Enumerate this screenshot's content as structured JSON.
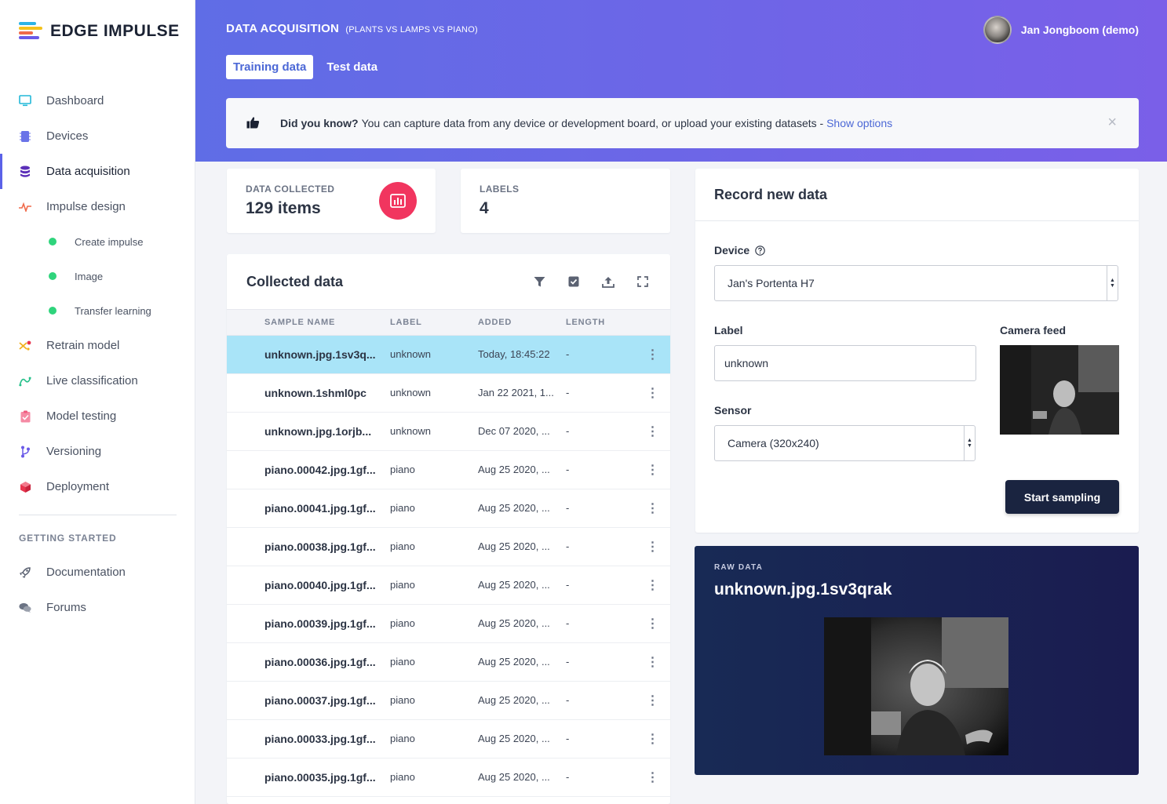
{
  "brand": {
    "name": "EDGE IMPULSE"
  },
  "nav": {
    "items": [
      {
        "label": "Dashboard",
        "icon": "monitor-icon",
        "color": "#22b8d8"
      },
      {
        "label": "Devices",
        "icon": "chip-icon",
        "color": "#6a73e8"
      },
      {
        "label": "Data acquisition",
        "icon": "database-icon",
        "color": "#5b2fb8"
      },
      {
        "label": "Impulse design",
        "icon": "pulse-icon",
        "color": "#f06a4a"
      }
    ],
    "sub_items": [
      {
        "label": "Create impulse"
      },
      {
        "label": "Image"
      },
      {
        "label": "Transfer learning"
      }
    ],
    "items2": [
      {
        "label": "Retrain model",
        "icon": "shuffle-icon",
        "color": "#f2b01e"
      },
      {
        "label": "Live classification",
        "icon": "graph-icon",
        "color": "#26c08a"
      },
      {
        "label": "Model testing",
        "icon": "clipboard-check-icon",
        "color": "#f05a7e"
      },
      {
        "label": "Versioning",
        "icon": "branch-icon",
        "color": "#6a5ae8"
      },
      {
        "label": "Deployment",
        "icon": "cube-icon",
        "color": "#e8354e"
      }
    ],
    "section_title": "GETTING STARTED",
    "help_items": [
      {
        "label": "Documentation",
        "icon": "rocket-icon"
      },
      {
        "label": "Forums",
        "icon": "chat-icon"
      }
    ]
  },
  "header": {
    "title": "DATA ACQUISITION",
    "subtitle": "(PLANTS VS LAMPS VS PIANO)",
    "user_name": "Jan Jongboom (demo)",
    "tabs": [
      {
        "label": "Training data"
      },
      {
        "label": "Test data"
      }
    ]
  },
  "banner": {
    "lead": "Did you know?",
    "text": "You can capture data from any device or development board, or upload your existing datasets -",
    "link": "Show options",
    "close": "×"
  },
  "stats": {
    "collected_label": "DATA COLLECTED",
    "collected_value": "129 items",
    "labels_label": "LABELS",
    "labels_value": "4"
  },
  "collected": {
    "title": "Collected data",
    "columns": [
      "SAMPLE NAME",
      "LABEL",
      "ADDED",
      "LENGTH"
    ],
    "rows": [
      {
        "name": "unknown.jpg.1sv3q...",
        "label": "unknown",
        "added": "Today, 18:45:22",
        "length": "-"
      },
      {
        "name": "unknown.1shml0pc",
        "label": "unknown",
        "added": "Jan 22 2021, 1...",
        "length": "-"
      },
      {
        "name": "unknown.jpg.1orjb...",
        "label": "unknown",
        "added": "Dec 07 2020, ...",
        "length": "-"
      },
      {
        "name": "piano.00042.jpg.1gf...",
        "label": "piano",
        "added": "Aug 25 2020, ...",
        "length": "-"
      },
      {
        "name": "piano.00041.jpg.1gf...",
        "label": "piano",
        "added": "Aug 25 2020, ...",
        "length": "-"
      },
      {
        "name": "piano.00038.jpg.1gf...",
        "label": "piano",
        "added": "Aug 25 2020, ...",
        "length": "-"
      },
      {
        "name": "piano.00040.jpg.1gf...",
        "label": "piano",
        "added": "Aug 25 2020, ...",
        "length": "-"
      },
      {
        "name": "piano.00039.jpg.1gf...",
        "label": "piano",
        "added": "Aug 25 2020, ...",
        "length": "-"
      },
      {
        "name": "piano.00036.jpg.1gf...",
        "label": "piano",
        "added": "Aug 25 2020, ...",
        "length": "-"
      },
      {
        "name": "piano.00037.jpg.1gf...",
        "label": "piano",
        "added": "Aug 25 2020, ...",
        "length": "-"
      },
      {
        "name": "piano.00033.jpg.1gf...",
        "label": "piano",
        "added": "Aug 25 2020, ...",
        "length": "-"
      },
      {
        "name": "piano.00035.jpg.1gf...",
        "label": "piano",
        "added": "Aug 25 2020, ...",
        "length": "-"
      }
    ]
  },
  "record": {
    "title": "Record new data",
    "device_label": "Device",
    "device_value": "Jan's Portenta H7",
    "label_label": "Label",
    "label_value": "unknown",
    "camera_label": "Camera feed",
    "sensor_label": "Sensor",
    "sensor_value": "Camera (320x240)",
    "start_button": "Start sampling"
  },
  "raw": {
    "label": "RAW DATA",
    "title": "unknown.jpg.1sv3qrak"
  },
  "colors": {
    "accent": "#4c68d6",
    "header_from": "#5f6de6",
    "header_to": "#7a5fe8",
    "selected_row": "#a9e4f8",
    "stat_icon": "#f1355f",
    "dark_button": "#1a2440"
  }
}
